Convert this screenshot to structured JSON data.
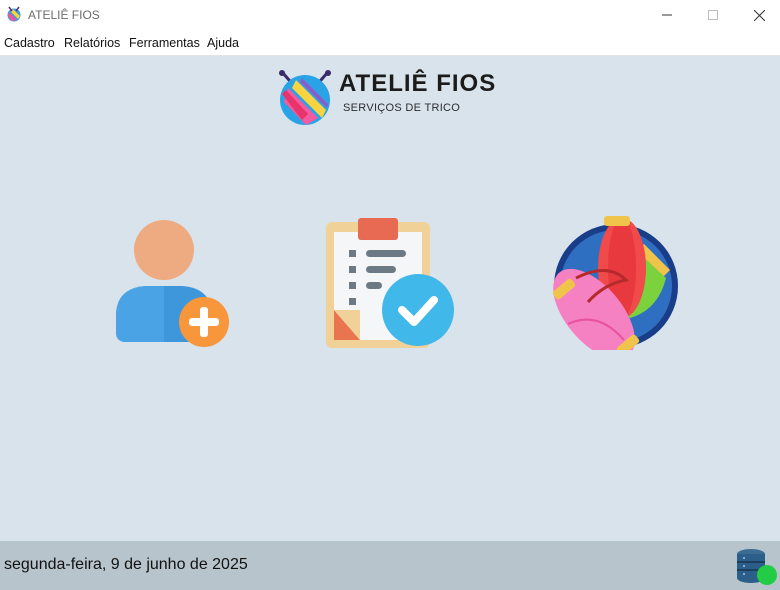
{
  "window": {
    "title": "ATELIÊ FIOS",
    "controls": [
      "minimize-icon",
      "maximize-icon",
      "close-icon"
    ]
  },
  "menu": {
    "items": [
      {
        "label": "Cadastro"
      },
      {
        "label": "Relatórios"
      },
      {
        "label": "Ferramentas"
      },
      {
        "label": "Ajuda"
      }
    ]
  },
  "brand": {
    "name": "ATELIÊ FIOS",
    "subtitle": "SERVIÇOS DE TRICO",
    "logo_icon": "knitting-logo-icon"
  },
  "tiles": [
    {
      "icon": "add-customer-icon"
    },
    {
      "icon": "clipboard-check-icon"
    },
    {
      "icon": "yarn-ball-icon"
    }
  ],
  "status": {
    "date": "segunda-feira, 9 de junho de 2025",
    "db_icon": "database-connected-icon",
    "connection_color": "#22cc44"
  },
  "colors": {
    "background": "#d8e3ec",
    "statusbar": "#b8c4cc"
  }
}
